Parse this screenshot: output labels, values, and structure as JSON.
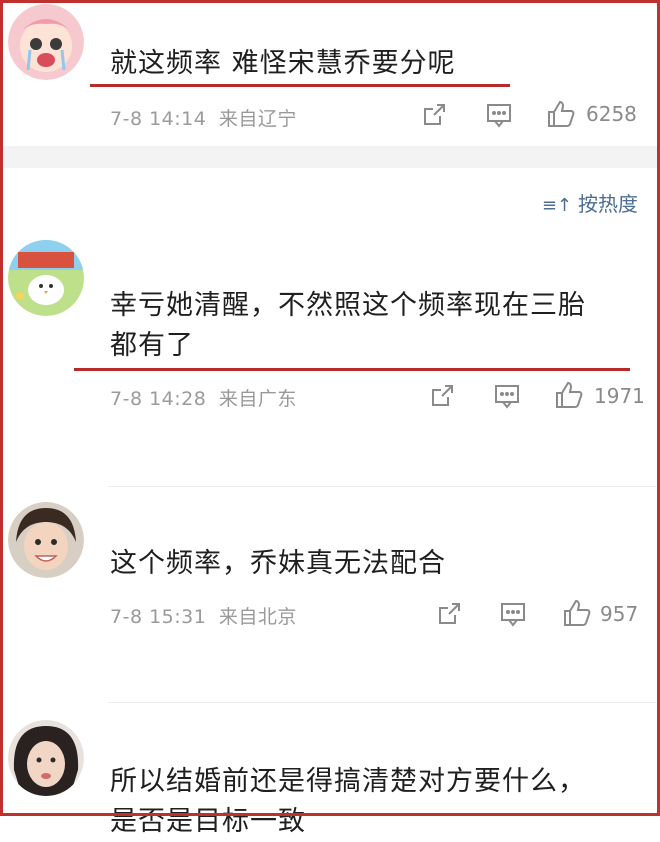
{
  "sort": {
    "label": "按热度"
  },
  "comments": [
    {
      "text_lines": [
        "就这频率 难怪宋慧乔要分呢"
      ],
      "time": "7-8 14:14",
      "location": "来自辽宁",
      "likes": "6258",
      "highlighted": true
    },
    {
      "text_lines": [
        "幸亏她清醒，不然照这个频率现在三胎",
        "都有了"
      ],
      "time": "7-8 14:28",
      "location": "来自广东",
      "likes": "1971",
      "highlighted": true
    },
    {
      "text_lines": [
        "这个频率，乔妹真无法配合"
      ],
      "time": "7-8 15:31",
      "location": "来自北京",
      "likes": "957",
      "highlighted": false
    },
    {
      "text_lines": [
        "所以结婚前还是得搞清楚对方要什么，",
        "是否是目标一致"
      ],
      "highlighted": false
    }
  ],
  "colors": {
    "highlight_underline": "#b82a2a",
    "frame": "#c0312e",
    "link": "#4d6d93",
    "meta_text": "#9a9a9a"
  },
  "icons": [
    "share-icon",
    "comment-icon",
    "like-icon",
    "sort-icon"
  ]
}
